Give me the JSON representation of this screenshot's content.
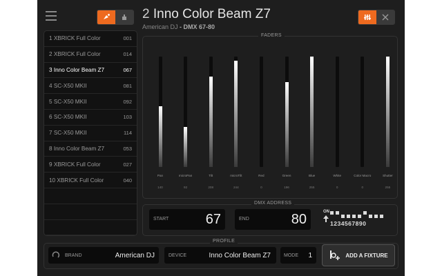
{
  "header": {
    "fixture_number": "2",
    "fixture_name": "Inno Color Beam Z7",
    "brand": "American DJ",
    "dmx_range": " - DMX 67-80"
  },
  "colors": {
    "accent": "#ee6a1f",
    "background": "#1e1e1e",
    "list_bg": "#121212"
  },
  "fixtures": [
    {
      "label": "1 XBRICK Full Color",
      "address": "001"
    },
    {
      "label": "2 XBRICK Full Color",
      "address": "014"
    },
    {
      "label": "3 Inno Color Beam Z7",
      "address": "067"
    },
    {
      "label": "4 SC-X50 MKII",
      "address": "081"
    },
    {
      "label": "5 SC-X50 MKII",
      "address": "092"
    },
    {
      "label": "6 SC-X50 MKII",
      "address": "103"
    },
    {
      "label": "7 SC-X50 MKII",
      "address": "114"
    },
    {
      "label": "8 Inno Color Beam Z7",
      "address": "053"
    },
    {
      "label": "9 XBRICK Full Color",
      "address": "027"
    },
    {
      "label": "10 XBRICK Full Color",
      "address": "040"
    }
  ],
  "faders": {
    "title": "FADERS",
    "channels": [
      {
        "name": "Pan",
        "value": "140",
        "level": 0.55
      },
      {
        "name": "microPan",
        "value": "92",
        "level": 0.36
      },
      {
        "name": "Tilt",
        "value": "208",
        "level": 0.82
      },
      {
        "name": "microTilt",
        "value": "244",
        "level": 0.96
      },
      {
        "name": "Red",
        "value": "0",
        "level": 0
      },
      {
        "name": "Green",
        "value": "196",
        "level": 0.77
      },
      {
        "name": "Blue",
        "value": "255",
        "level": 1.0
      },
      {
        "name": "White",
        "value": "0",
        "level": 0
      },
      {
        "name": "Color Macro",
        "value": "0",
        "level": 0
      },
      {
        "name": "Shutter",
        "value": "255",
        "level": 1.0
      }
    ]
  },
  "dmx": {
    "title": "DMX ADDRESS",
    "start_label": "START",
    "start_value": "67",
    "end_label": "END",
    "end_value": "80",
    "on_label": "ON",
    "dip_numbers": "1234567890"
  },
  "profile": {
    "title": "PROFILE",
    "brand_label": "BRAND",
    "brand_value": "American DJ",
    "device_label": "DEVICE",
    "device_value": "Inno Color Beam Z7",
    "mode_label": "MODE",
    "mode_value": "1",
    "add_button": "ADD A FIXTURE"
  },
  "icons": {
    "menu": "hamburger-icon",
    "fixture_mode": "spotlight-icon",
    "hand_mode": "hand-icon",
    "faders_view": "sliders-icon",
    "fullscreen": "expand-icon",
    "brand": "refresh-icon",
    "add": "add-fixture-icon"
  }
}
